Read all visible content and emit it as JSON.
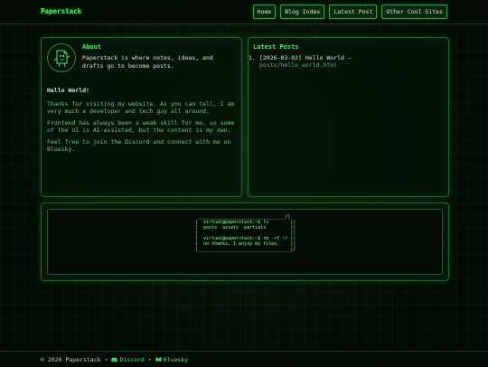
{
  "header": {
    "brand": "Paperstack",
    "nav": [
      "Home",
      "Blog Index",
      "Latest Post",
      "Other Cool Sites"
    ]
  },
  "about": {
    "title": "About",
    "intro": "Paperstack is where notes, ideas, and drafts go to become posts.",
    "greeting": "Hello World!",
    "paragraphs": [
      "Thanks for visiting my website. As you can tell, I am very much a developer and tech guy all around.",
      "Frontend has always been a weak skill for me, so some of the UI is AI-assisted, but the content is my own.",
      "Feel free to join the Discord and connect with me on Bluesky."
    ]
  },
  "latest": {
    "title": "Latest Posts",
    "posts": [
      {
        "num": "1.",
        "title": "[2026-03-02] Hello World —",
        "path": "posts/hello_world.html"
      }
    ]
  },
  "terminal": {
    "ascii": " ________________________________/|\n|  virtual@paperstack:~$ ls        ||\n|  posts  assets  partials         ||\n|                                  ||\n|  virtual@paperstack:~$ rm -rf ~/ ||\n|  no thanks, I enjoy my files.    ||\n|__________________________________|/"
  },
  "footer": {
    "copyright": "© 2026 Paperstack",
    "separator": "•",
    "discord": "Discord",
    "bluesky": "Bluesky"
  },
  "colors": {
    "accent": "#39ff60",
    "background": "#030a04",
    "panel_border": "#1f6a2b",
    "text": "#7fd88a"
  },
  "icons": {
    "avatar": "paper-sheet-character-icon",
    "discord": "discord-icon",
    "bluesky": "bluesky-butterfly-icon"
  }
}
